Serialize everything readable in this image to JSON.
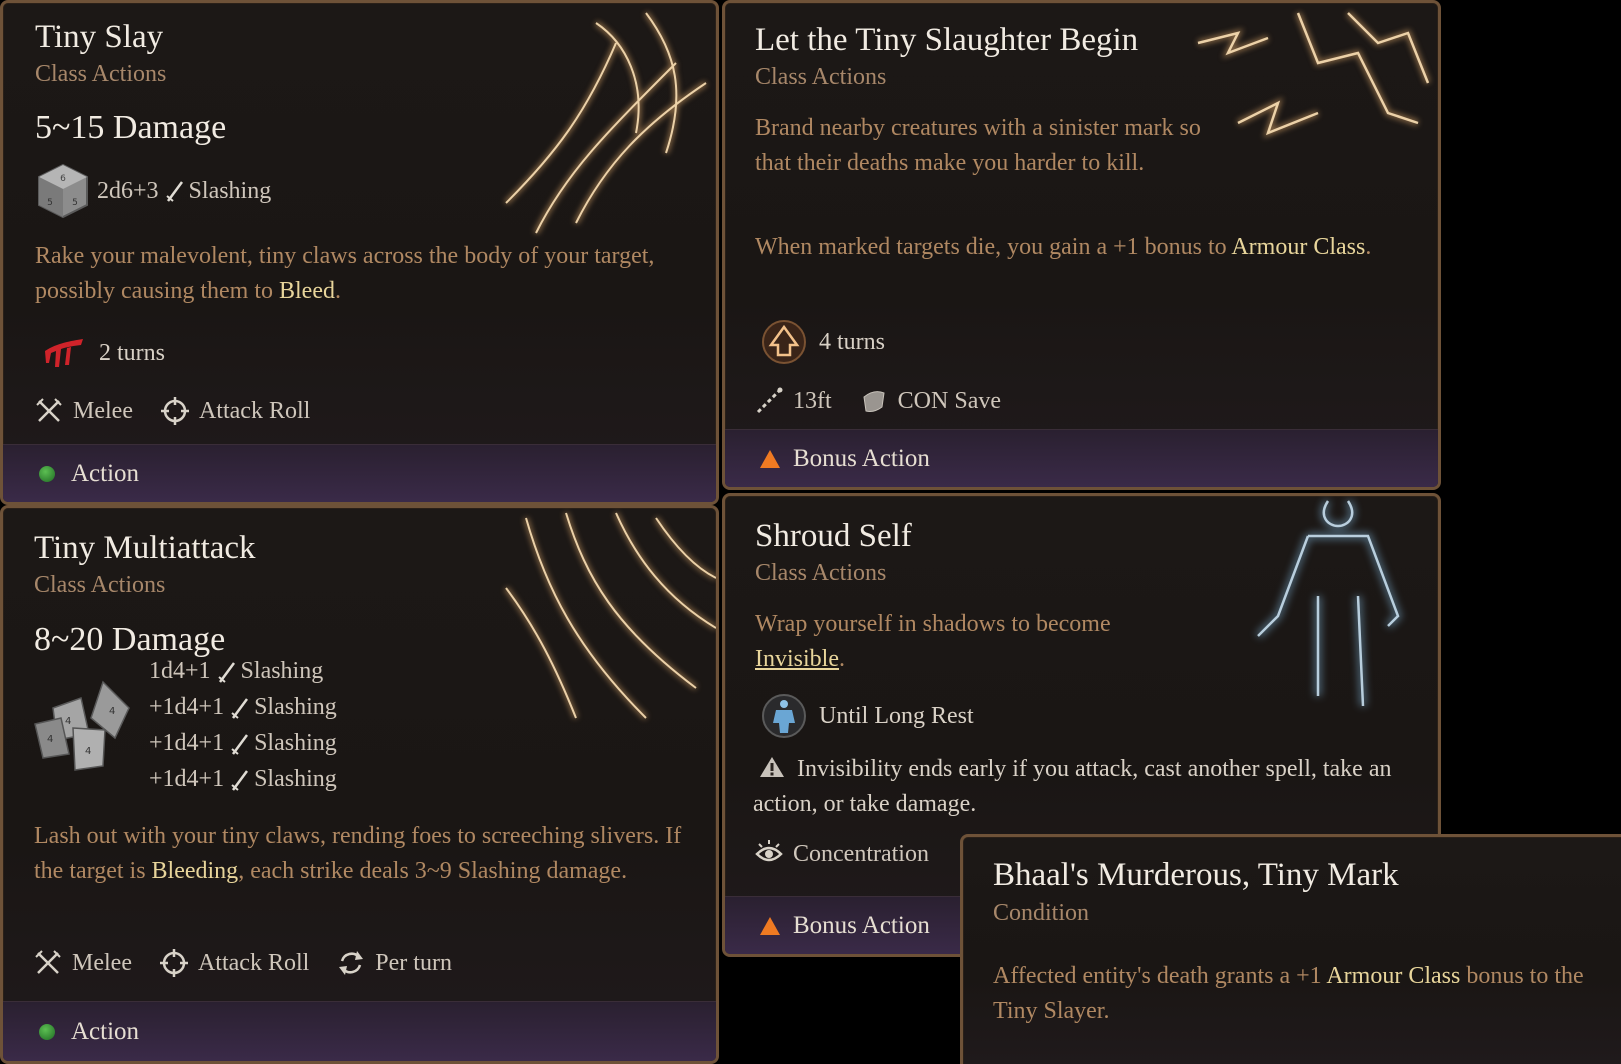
{
  "cards": {
    "tiny_slay": {
      "title": "Tiny Slay",
      "subtitle": "Class Actions",
      "damage": "5~15 Damage",
      "dice": "2d6+3",
      "damage_type": "Slashing",
      "desc_part1": "Rake your malevolent, tiny claws across the body of your target, possibly causing them to ",
      "desc_keyword": "Bleed",
      "desc_end": ".",
      "duration": "2 turns",
      "tag1": "Melee",
      "tag2": "Attack Roll",
      "cost": "Action"
    },
    "tiny_slaughter": {
      "title": "Let the Tiny Slaughter Begin",
      "subtitle": "Class Actions",
      "desc1": "Brand nearby creatures with a sinister mark so that their deaths make you harder to kill.",
      "desc2_part1": "When marked targets die, you gain a +1 bonus to ",
      "desc2_keyword": "Armour Class",
      "desc2_end": ".",
      "duration": "4 turns",
      "range": "13ft",
      "save": "CON Save",
      "cost": "Bonus Action"
    },
    "tiny_multiattack": {
      "title": "Tiny Multiattack",
      "subtitle": "Class Actions",
      "damage": "8~20 Damage",
      "dice_lines": [
        "1d4+1",
        "+1d4+1",
        "+1d4+1",
        "+1d4+1"
      ],
      "damage_type": "Slashing",
      "desc_part1": "Lash out with your tiny claws, rending foes to screeching slivers. If the target is ",
      "desc_keyword": "Bleeding",
      "desc_part2": ", each strike deals 3~9 Slashing damage.",
      "tag1": "Melee",
      "tag2": "Attack Roll",
      "tag3": "Per turn",
      "cost": "Action"
    },
    "shroud_self": {
      "title": "Shroud Self",
      "subtitle": "Class Actions",
      "desc_part1": "Wrap yourself in shadows to become ",
      "desc_keyword": "Invisible",
      "desc_end": ".",
      "duration": "Until Long Rest",
      "warning": "Invisibility ends early if you attack, cast another spell, take an action, or take damage.",
      "concentration": "Concentration",
      "cost": "Bonus Action"
    },
    "bhaal_mark": {
      "title": "Bhaal's Murderous, Tiny Mark",
      "subtitle": "Condition",
      "desc_part1": "Affected entity's death grants a +1 ",
      "desc_keyword": "Armour Class",
      "desc_part2": " bonus to the Tiny Slayer."
    }
  },
  "colors": {
    "border": "#6e5238",
    "title": "#f1ebe2",
    "subtitle": "#a7876a",
    "description": "#b08862",
    "keyword": "#e8d59b",
    "action_dot": "#3f9a3a",
    "bonus_triangle": "#ef7a22",
    "footer": "#3a2a48"
  },
  "icons": [
    "die-icon",
    "sword-icon",
    "bleed-icon",
    "melee-icon",
    "target-icon",
    "armour-up-icon",
    "range-icon",
    "shield-icon",
    "invisible-figure-icon",
    "warning-icon",
    "concentration-icon",
    "refresh-icon",
    "dice-pile-icon"
  ]
}
